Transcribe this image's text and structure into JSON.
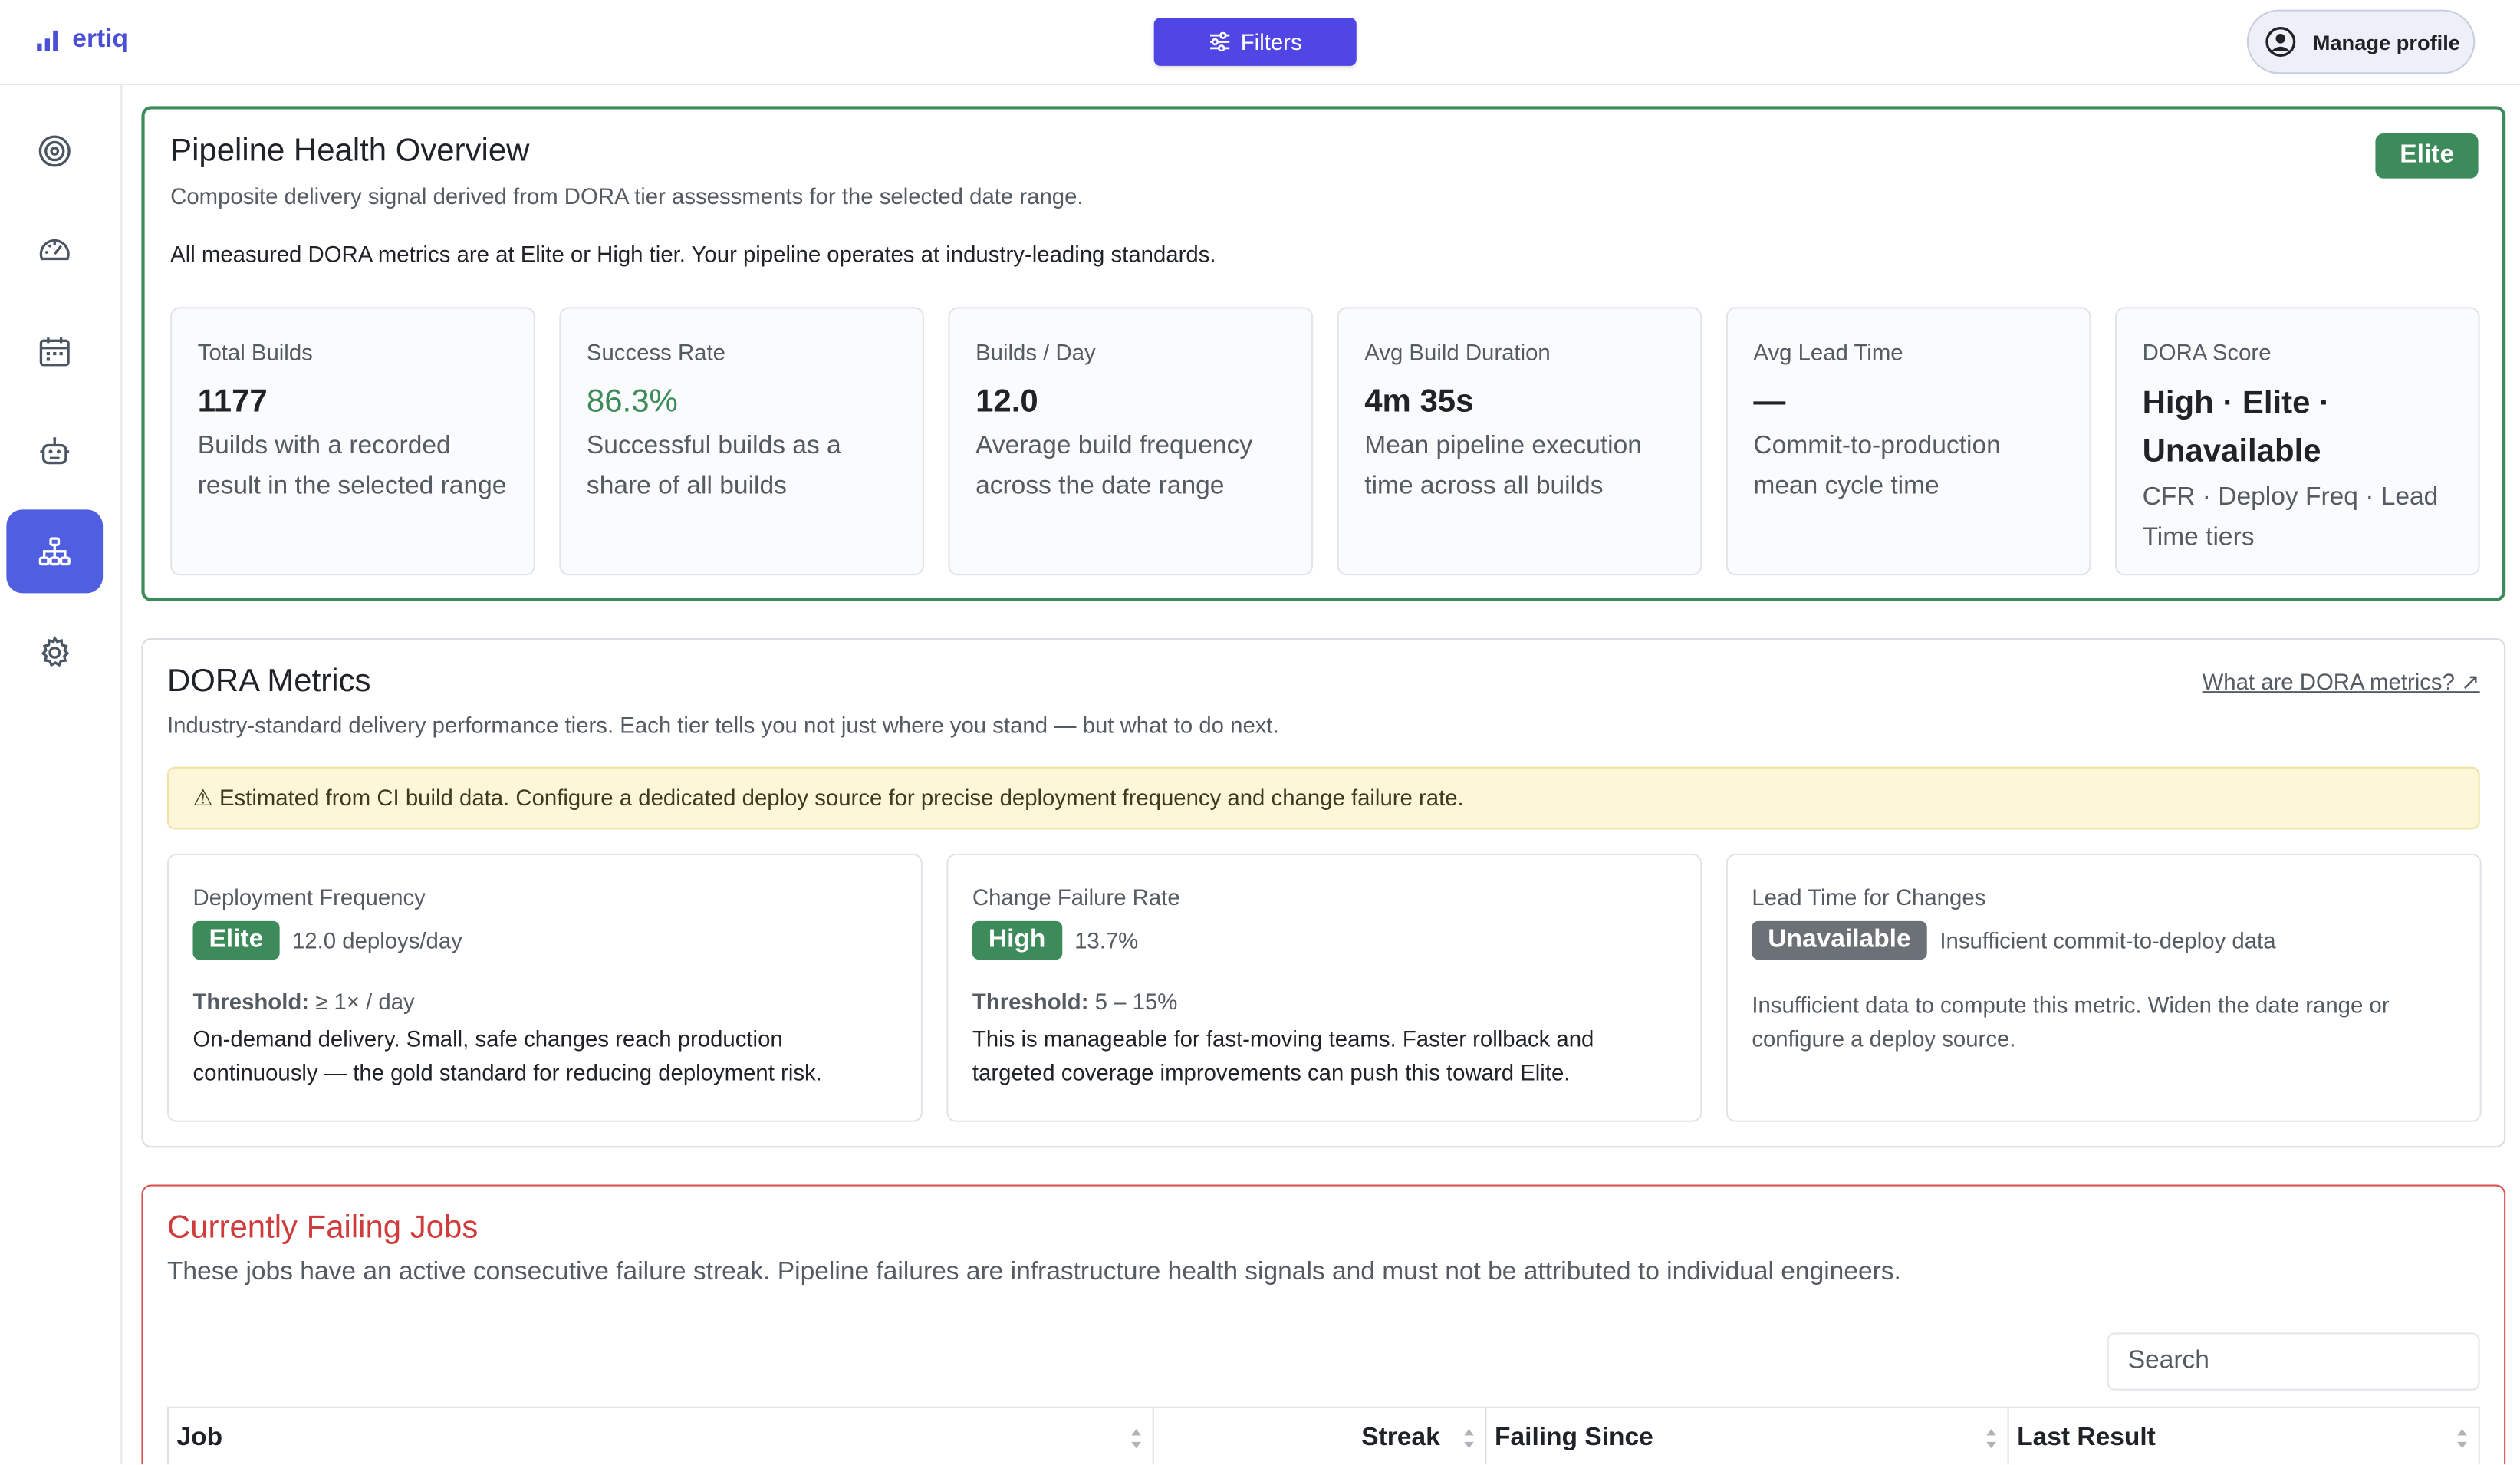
{
  "brand": {
    "name": "ertiq"
  },
  "header": {
    "filters_label": "Filters",
    "profile_label": "Manage profile"
  },
  "sidebar": {
    "items": [
      {
        "icon": "target-icon",
        "active": false
      },
      {
        "icon": "gauge-icon",
        "active": false
      },
      {
        "icon": "calendar-icon",
        "active": false
      },
      {
        "icon": "robot-icon",
        "active": false
      },
      {
        "icon": "sitemap-icon",
        "active": true
      },
      {
        "icon": "gear-icon",
        "active": false
      }
    ]
  },
  "health": {
    "title": "Pipeline Health Overview",
    "subtitle": "Composite delivery signal derived from DORA tier assessments for the selected date range.",
    "message": "All measured DORA metrics are at Elite or High tier. Your pipeline operates at industry-leading standards.",
    "badge": "Elite",
    "stats": [
      {
        "label": "Total Builds",
        "value": "1177",
        "desc": "Builds with a recorded result in the selected range"
      },
      {
        "label": "Success Rate",
        "value": "86.3%",
        "desc": "Successful builds as a share of all builds"
      },
      {
        "label": "Builds / Day",
        "value": "12.0",
        "desc": "Average build frequency across the date range"
      },
      {
        "label": "Avg Build Duration",
        "value": "4m 35s",
        "desc": "Mean pipeline execution time across all builds"
      },
      {
        "label": "Avg Lead Time",
        "value": "—",
        "desc": "Commit-to-production mean cycle time"
      },
      {
        "label": "DORA Score",
        "value": "High · Elite · Unavailable",
        "desc": "CFR · Deploy Freq · Lead Time tiers"
      }
    ]
  },
  "dora": {
    "title": "DORA Metrics",
    "link": "What are DORA metrics? ↗",
    "subtitle": "Industry-standard delivery performance tiers. Each tier tells you not just where you stand — but what to do next.",
    "warning": "⚠ Estimated from CI build data. Configure a dedicated deploy source for precise deployment frequency and change failure rate.",
    "metrics": [
      {
        "label": "Deployment Frequency",
        "tier": "Elite",
        "value": "12.0 deploys/day",
        "threshold_label": "Threshold:",
        "threshold": "≥ 1× / day",
        "desc": "On-demand delivery. Small, safe changes reach production continuously — the gold standard for reducing deployment risk."
      },
      {
        "label": "Change Failure Rate",
        "tier": "High",
        "value": "13.7%",
        "threshold_label": "Threshold:",
        "threshold": "5 – 15%",
        "desc": "This is manageable for fast-moving teams. Faster rollback and targeted coverage improvements can push this toward Elite."
      },
      {
        "label": "Lead Time for Changes",
        "tier": "Unavailable",
        "value": "Insufficient commit-to-deploy data",
        "desc": "Insufficient data to compute this metric. Widen the date range or configure a deploy source."
      }
    ]
  },
  "failing": {
    "title": "Currently Failing Jobs",
    "subtitle": "These jobs have an active consecutive failure streak. Pipeline failures are infrastructure health signals and must not be attributed to individual engineers.",
    "search_placeholder": "Search",
    "columns": [
      "Job",
      "Streak",
      "Failing Since",
      "Last Result"
    ]
  },
  "colors": {
    "accent": "#4f46e5",
    "elite": "#3d8a5a",
    "danger": "#d03b3b",
    "unavailable": "#6b7177"
  }
}
